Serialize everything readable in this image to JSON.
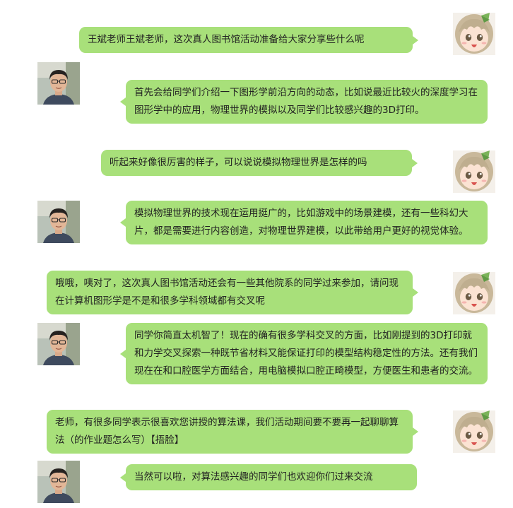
{
  "messages": [
    {
      "side": "student",
      "text": "王斌老师王斌老师，这次真人图书馆活动准备给大家分享些什么呢"
    },
    {
      "side": "teacher",
      "text": "首先会给同学们介绍一下图形学前沿方向的动态，比如说最近比较火的深度学习在图形学中的应用，物理世界的模拟以及同学们比较感兴趣的3D打印。"
    },
    {
      "side": "student",
      "text": "听起来好像很厉害的样子，可以说说模拟物理世界是怎样的吗"
    },
    {
      "side": "teacher",
      "text": "模拟物理世界的技术现在运用挺广的，比如游戏中的场景建模，还有一些科幻大片，都是需要进行内容创造，对物理世界建模，以此带给用户更好的视觉体验。"
    },
    {
      "side": "student",
      "text": "哦哦，咦对了，这次真人图书馆活动还会有一些其他院系的同学过来参加，请问现在计算机图形学是不是和很多学科领域都有交叉呢"
    },
    {
      "side": "teacher",
      "text": "同学你简直太机智了！现在的确有很多学科交叉的方面，比如刚提到的3D打印就和力学交叉探索一种既节省材料又能保证打印的模型结构稳定性的方法。还有我们现在在和口腔医学方面结合，用电脑模拟口腔正畸模型，方便医生和患者的交流。"
    },
    {
      "side": "student",
      "text": "老师，有很多同学表示很喜欢您讲授的算法课，我们活动期间要不要再一起聊聊算法（的作业题怎么写）【捂脸】"
    },
    {
      "side": "teacher",
      "text": "当然可以啦，对算法感兴趣的同学们也欢迎你们过来交流"
    }
  ],
  "avatars": {
    "student_icon": "anime-girl-avatar",
    "teacher_icon": "teacher-photo-avatar"
  },
  "colors": {
    "bubble": "#a8e07a",
    "background": "#ffffff"
  }
}
